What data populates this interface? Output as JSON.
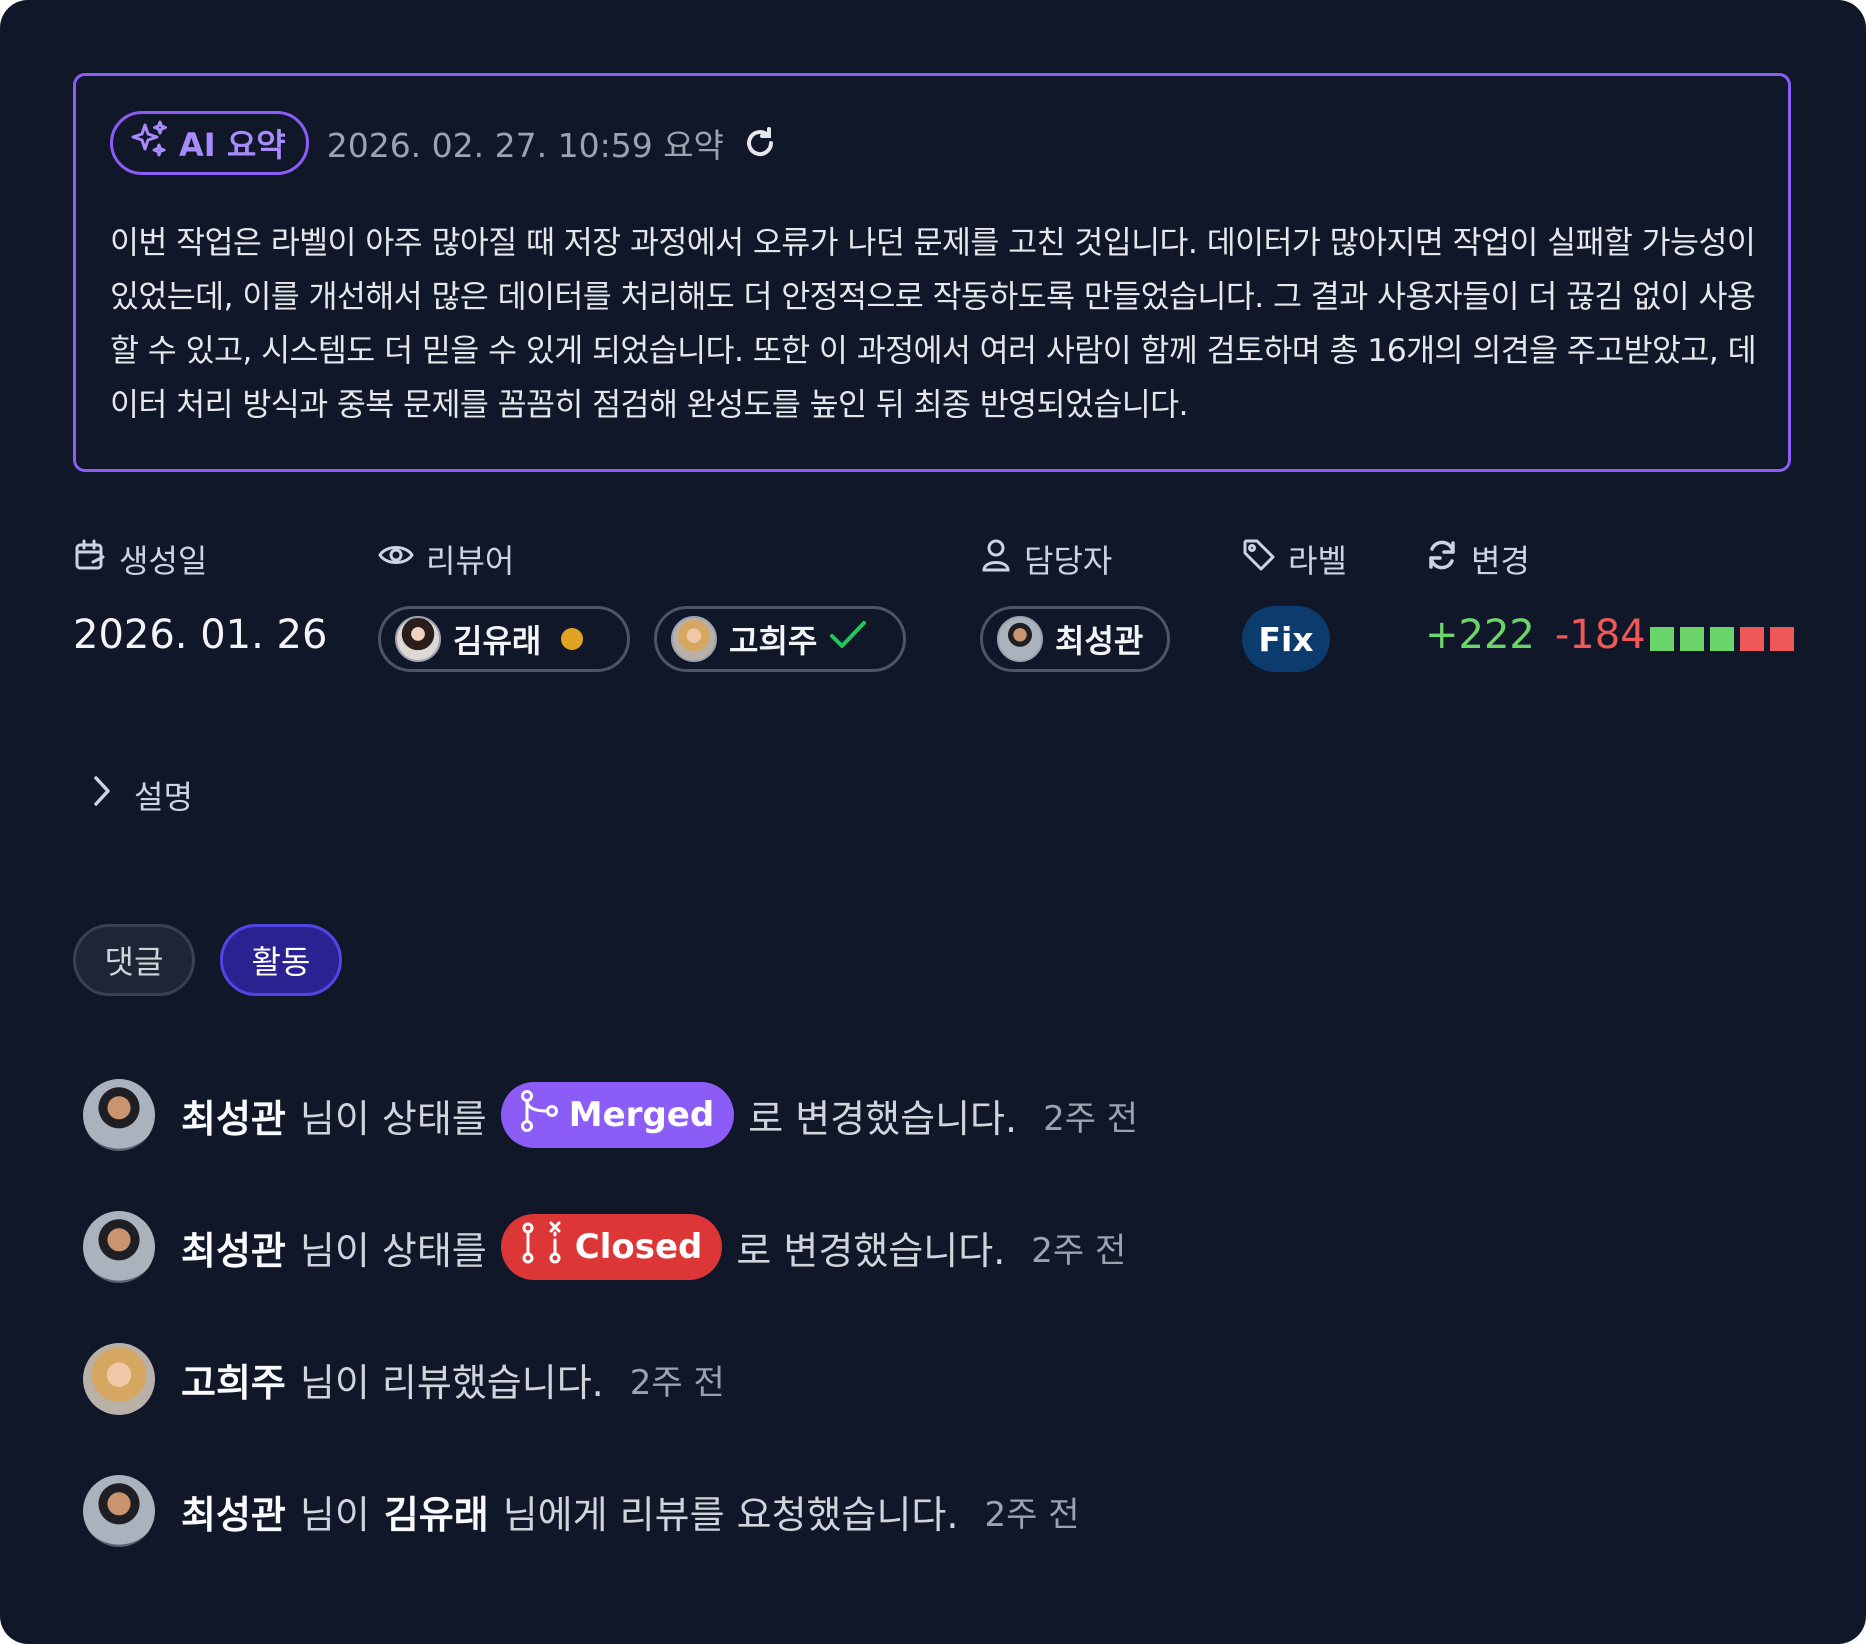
{
  "ai_summary": {
    "chip_label": "AI 요약",
    "timestamp": "2026. 02. 27. 10:59 요약",
    "text": "이번 작업은 라벨이 아주 많아질 때 저장 과정에서 오류가 나던 문제를 고친 것입니다. 데이터가 많아지면 작업이 실패할 가능성이 있었는데, 이를 개선해서 많은 데이터를 처리해도 더 안정적으로 작동하도록 만들었습니다. 그 결과 사용자들이 더 끊김 없이 사용할 수 있고, 시스템도 더 믿을 수 있게 되었습니다. 또한 이 과정에서 여러 사람이 함께 검토하며 총 16개의 의견을 주고받았고, 데이터 처리 방식과 중복 문제를 꼼꼼히 점검해 완성도를 높인 뒤 최종 반영되었습니다."
  },
  "meta": {
    "created_label": "생성일",
    "created_value": "2026. 01. 26",
    "reviewers_label": "리뷰어",
    "reviewers": [
      {
        "name": "김유래",
        "status": "pending"
      },
      {
        "name": "고희주",
        "status": "approved"
      }
    ],
    "assignee_label": "담당자",
    "assignee": "최성관",
    "labels_label": "라벨",
    "label_value": "Fix",
    "changes_label": "변경",
    "additions": "+222",
    "deletions": "-184",
    "diff_blocks": [
      "add",
      "add",
      "add",
      "del",
      "del"
    ]
  },
  "description_label": "설명",
  "tabs": {
    "comments": "댓글",
    "activity": "활동",
    "active": "activity"
  },
  "activity": [
    {
      "actor": "최성관",
      "text_before": "님이 상태를",
      "state": "Merged",
      "text_after": "로 변경했습니다.",
      "time": "2주 전"
    },
    {
      "actor": "최성관",
      "text_before": "님이 상태를",
      "state": "Closed",
      "text_after": "로 변경했습니다.",
      "time": "2주 전"
    },
    {
      "actor": "고희주",
      "text_before": "님이 리뷰했습니다.",
      "time": "2주 전"
    },
    {
      "actor": "최성관",
      "text_before": "님이",
      "target": "김유래",
      "text_after": "님에게 리뷰를 요청했습니다.",
      "time": "2주 전"
    }
  ],
  "colors": {
    "background": "#0f1729",
    "accent_purple": "#8b5cf6",
    "merged": "#8b5cf6",
    "closed": "#dc3636",
    "additions": "#6cd56a",
    "deletions": "#f05757",
    "label_fix": "#0c3b6e",
    "pending_dot": "#e0a422",
    "approved_check": "#22c55e"
  },
  "icons": [
    "sparkles-icon",
    "refresh-icon",
    "calendar-icon",
    "eye-icon",
    "user-icon",
    "tag-icon",
    "sync-icon",
    "chevron-right-icon",
    "check-icon",
    "git-merge-icon",
    "git-pull-request-closed-icon"
  ]
}
